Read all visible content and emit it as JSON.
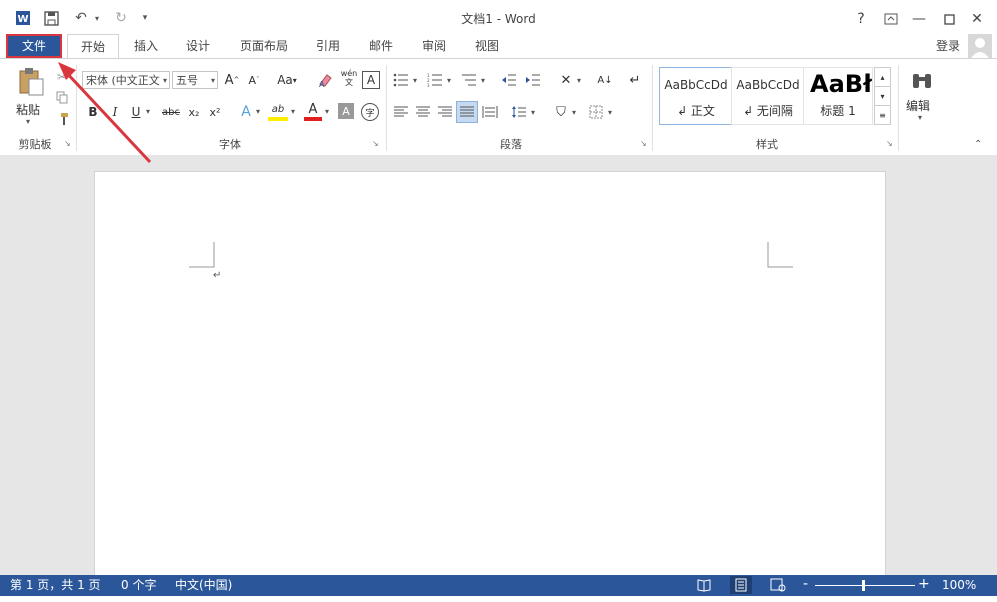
{
  "window": {
    "title": "文档1 - Word",
    "help": "?",
    "signin": "登录"
  },
  "icons": {
    "app": "word-logo-icon",
    "save": "save-icon",
    "undo": "undo-icon",
    "redo": "redo-icon",
    "customize": "customize-qat-icon",
    "ribbon_display": "ribbon-display-options-icon",
    "minimize": "minimize-icon",
    "maximize": "maximize-icon",
    "close": "close-icon",
    "avatar": "user-avatar-icon"
  },
  "tabs": [
    {
      "label": "文件"
    },
    {
      "label": "开始"
    },
    {
      "label": "插入"
    },
    {
      "label": "设计"
    },
    {
      "label": "页面布局"
    },
    {
      "label": "引用"
    },
    {
      "label": "邮件"
    },
    {
      "label": "审阅"
    },
    {
      "label": "视图"
    }
  ],
  "ribbon": {
    "clipboard": {
      "label": "剪贴板",
      "paste": "粘贴"
    },
    "font": {
      "label": "字体",
      "font_name": "宋体 (中文正文",
      "font_size": "五号",
      "grow": "A",
      "shrink": "A",
      "change_case": "Aa",
      "pinyin_top": "wén",
      "pinyin_bottom": "文",
      "char_border": "A",
      "bold": "B",
      "italic": "I",
      "underline": "U",
      "strike": "abc",
      "subscript": "x₂",
      "superscript": "x²",
      "effects": "A",
      "highlight": "ab",
      "font_color": "A",
      "shading": "A",
      "enclose": "字"
    },
    "paragraph": {
      "label": "段落"
    },
    "styles": {
      "label": "样式",
      "items": [
        {
          "sample": "AaBbCcDd",
          "name": "↲ 正文"
        },
        {
          "sample": "AaBbCcDd",
          "name": "↲ 无间隔"
        },
        {
          "sample": "AaBł",
          "name": "标题 1"
        }
      ]
    },
    "editing": {
      "label": "编辑"
    }
  },
  "document": {
    "paragraph_mark": "↵"
  },
  "status": {
    "page": "第 1 页，共 1 页",
    "words": "0 个字",
    "language": "中文(中国)",
    "zoom_minus": "-",
    "zoom_plus": "+",
    "zoom": "100%"
  },
  "colors": {
    "accent": "#2b579a",
    "annotation": "#d9363e"
  }
}
